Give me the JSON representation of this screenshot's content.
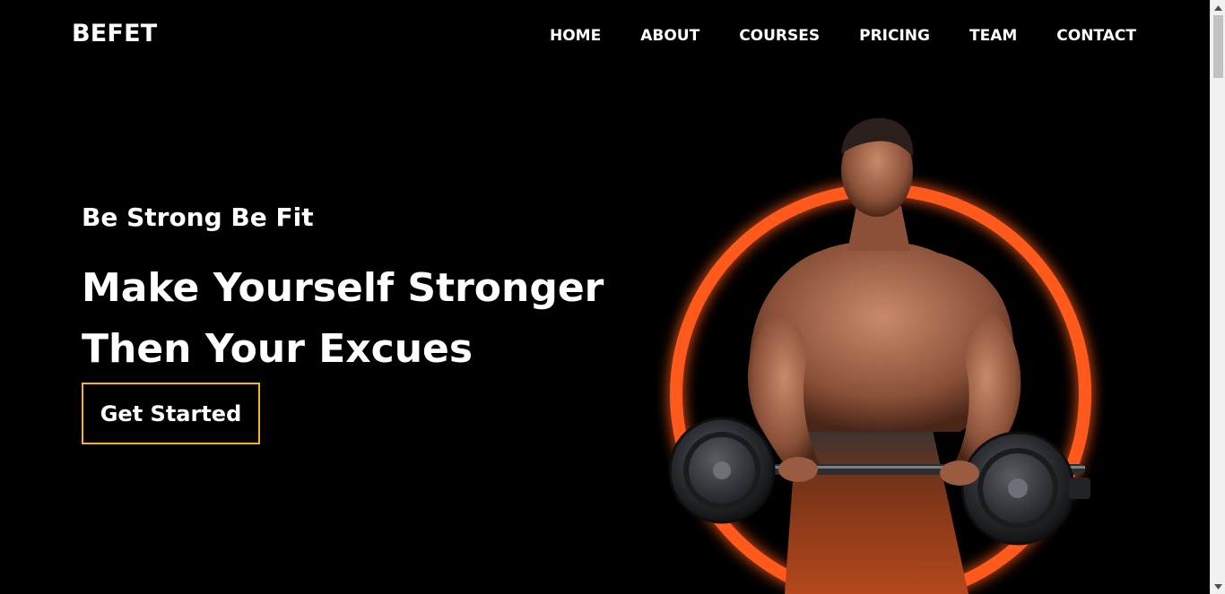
{
  "brand": {
    "logo": "BEFET"
  },
  "nav": {
    "items": [
      "HOME",
      "ABOUT",
      "COURSES",
      "PRICING",
      "TEAM",
      "CONTACT"
    ]
  },
  "hero": {
    "tagline": "Be Strong Be Fit",
    "headline_line1": "Make Yourself Stronger",
    "headline_line2": "Then Your Excues",
    "cta_label": "Get Started"
  },
  "colors": {
    "background": "#000000",
    "text": "#ffffff",
    "cta_border": "#f3b52b",
    "ring": "#ff5a1f"
  },
  "icons": {
    "scroll_up": "scroll-up-arrow-icon",
    "scroll_down": "scroll-down-arrow-icon"
  }
}
